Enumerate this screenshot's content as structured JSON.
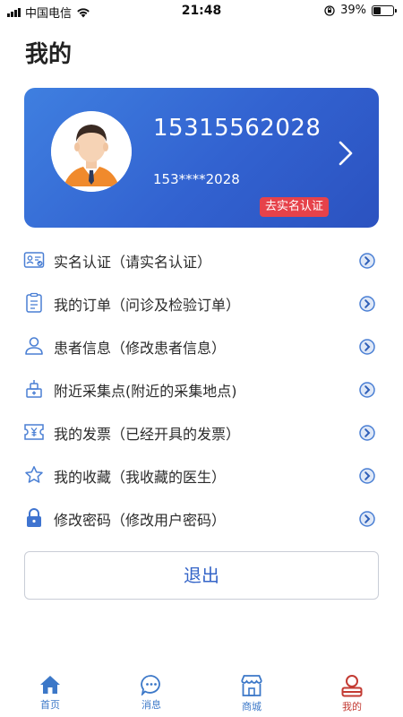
{
  "status_bar": {
    "carrier": "中国电信",
    "time": "21:48",
    "battery": "39%",
    "battery_level": 0.39
  },
  "page": {
    "title": "我的"
  },
  "profile": {
    "phone": "15315562028",
    "phone_masked": "153****2028",
    "verify_badge": "去实名认证"
  },
  "menu": {
    "items": [
      {
        "icon": "id-card-icon",
        "label": "实名认证（请实名认证）"
      },
      {
        "icon": "order-list-icon",
        "label": "我的订单（问诊及检验订单）"
      },
      {
        "icon": "person-icon",
        "label": "患者信息（修改患者信息）"
      },
      {
        "icon": "collection-point-icon",
        "label": "附近采集点(附近的采集地点)"
      },
      {
        "icon": "invoice-icon",
        "label": "我的发票（已经开具的发票）"
      },
      {
        "icon": "star-icon",
        "label": "我的收藏（我收藏的医生）"
      },
      {
        "icon": "lock-icon",
        "label": "修改密码（修改用户密码）"
      }
    ]
  },
  "logout": {
    "label": "退出"
  },
  "tab_bar": {
    "tabs": [
      {
        "icon": "home-icon",
        "label": "首页"
      },
      {
        "icon": "message-icon",
        "label": "消息"
      },
      {
        "icon": "store-icon",
        "label": "商城"
      },
      {
        "icon": "profile-icon",
        "label": "我的",
        "active": true
      }
    ]
  },
  "colors": {
    "card_blue": "#3262d0",
    "badge_red": "#e6424a",
    "tab_blue": "#3c78c8",
    "tab_active_red": "#c33b33"
  }
}
